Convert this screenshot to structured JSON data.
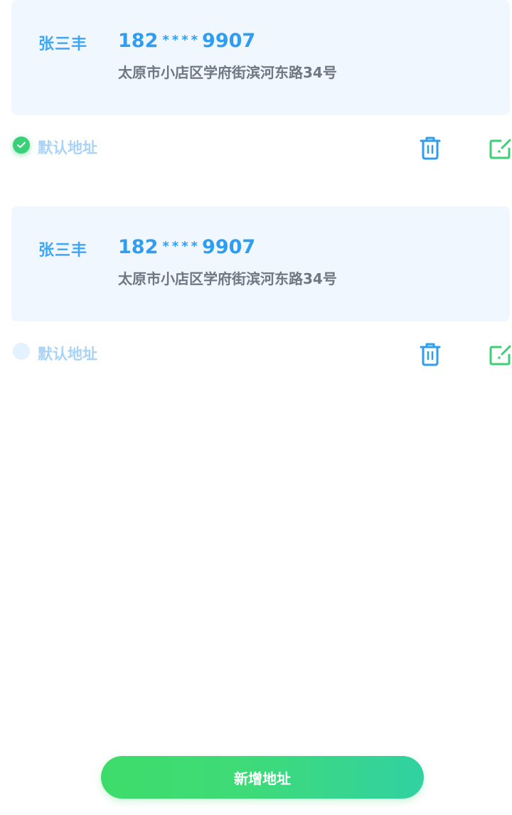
{
  "colors": {
    "accent_blue": "#2f9df0",
    "card_bg": "#f0f7fe",
    "check_green": "#3ad07a",
    "edit_green": "#3ccf76",
    "label_light_blue": "#a9d3f6"
  },
  "addresses": [
    {
      "name": "张三丰",
      "phone_prefix": "182",
      "phone_mask": "****",
      "phone_suffix": "9907",
      "address": "太原市小店区学府街滨河东路34号",
      "default_label": "默认地址",
      "is_default": true,
      "delete_icon": "trash-icon",
      "edit_icon": "edit-icon"
    },
    {
      "name": "张三丰",
      "phone_prefix": "182",
      "phone_mask": "****",
      "phone_suffix": "9907",
      "address": "太原市小店区学府街滨河东路34号",
      "default_label": "默认地址",
      "is_default": false,
      "delete_icon": "trash-icon",
      "edit_icon": "edit-icon"
    }
  ],
  "footer": {
    "add_button_label": "新增地址"
  }
}
